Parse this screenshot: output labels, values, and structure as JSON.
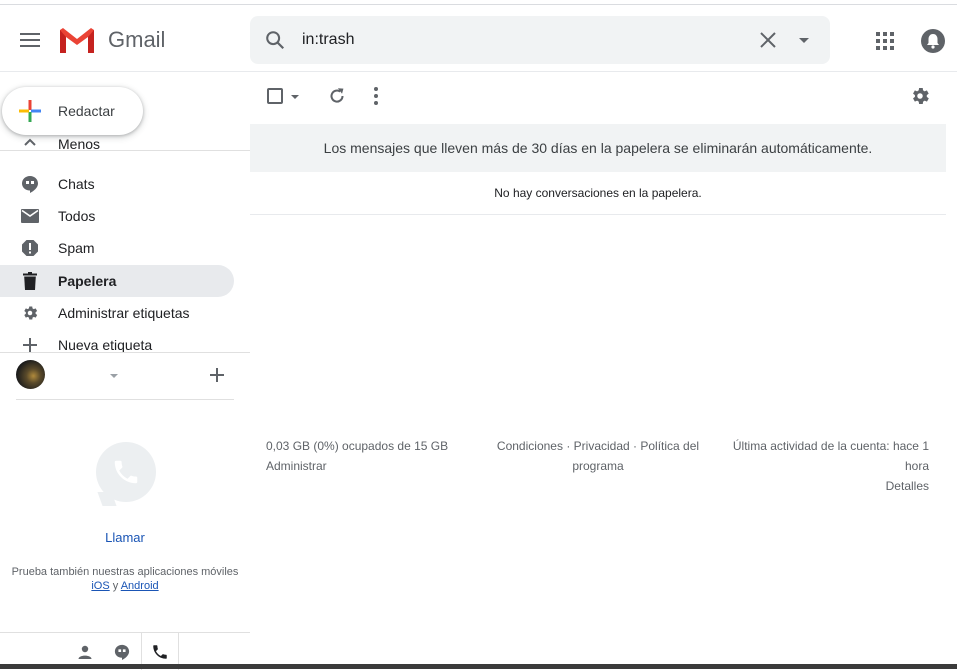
{
  "header": {
    "app_name": "Gmail",
    "search_value": "in:trash"
  },
  "compose": {
    "label": "Redactar"
  },
  "nav": {
    "items": [
      {
        "label": "Menos",
        "icon": "chevron-up-icon"
      },
      {
        "label": "Chats",
        "icon": "chat-icon"
      },
      {
        "label": "Todos",
        "icon": "mail-icon"
      },
      {
        "label": "Spam",
        "icon": "spam-icon"
      },
      {
        "label": "Papelera",
        "icon": "trash-icon",
        "active": true
      },
      {
        "label": "Administrar etiquetas",
        "icon": "gear-icon"
      },
      {
        "label": "Nueva etiqueta",
        "icon": "plus-icon"
      }
    ]
  },
  "hangouts": {
    "call_label": "Llamar",
    "promo_text": "Prueba también nuestras aplicaciones móviles",
    "ios_link": "iOS",
    "and_word": "y",
    "android_link": "Android"
  },
  "main": {
    "banner": "Los mensajes que lleven más de 30 días en la papelera se eliminarán automáticamente.",
    "empty_text": "No hay conversaciones en la papelera."
  },
  "footer": {
    "storage": "0,03 GB (0%) ocupados de 15 GB",
    "manage": "Administrar",
    "terms": "Condiciones",
    "privacy": "Privacidad",
    "policy": "Política del programa",
    "separator": "·",
    "activity": "Última actividad de la cuenta: hace 1 hora",
    "details": "Detalles"
  }
}
